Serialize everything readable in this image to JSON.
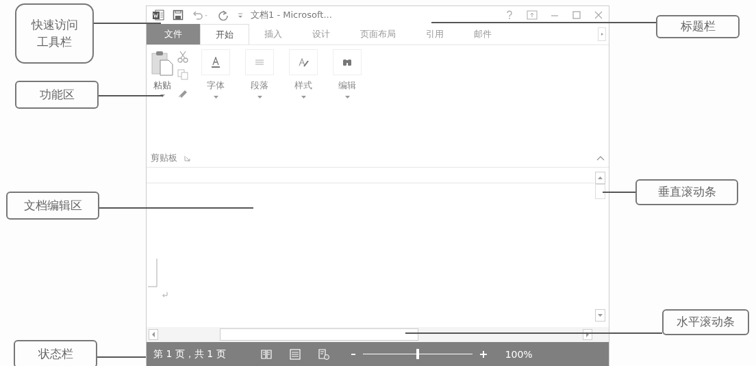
{
  "window": {
    "title": "文档1 - Microsoft..."
  },
  "tabs": [
    {
      "label": "文件",
      "kind": "file",
      "selected": false
    },
    {
      "label": "开始",
      "kind": "tab",
      "selected": true
    },
    {
      "label": "插入",
      "kind": "tab",
      "selected": false
    },
    {
      "label": "设计",
      "kind": "tab",
      "selected": false
    },
    {
      "label": "页面布局",
      "kind": "tab",
      "selected": false
    },
    {
      "label": "引用",
      "kind": "tab",
      "selected": false
    },
    {
      "label": "邮件",
      "kind": "tab",
      "selected": false
    }
  ],
  "ribbon": {
    "paste_label": "粘贴",
    "group_label": "剪贴板",
    "buttons": [
      {
        "label": "字体",
        "kind": "font"
      },
      {
        "label": "段落",
        "kind": "paragraph"
      },
      {
        "label": "样式",
        "kind": "styles"
      },
      {
        "label": "编辑",
        "kind": "find"
      }
    ]
  },
  "status_bar": {
    "page_info": "第 1 页，共 1 页",
    "zoom": {
      "level": 0.5,
      "reading": "100%"
    }
  },
  "callouts": [
    {
      "text": "快速访问工具栏",
      "kind": "rounded"
    },
    {
      "text": "功能区",
      "kind": "box"
    },
    {
      "text": "文档编辑区",
      "kind": "box"
    },
    {
      "text": "状态栏",
      "kind": "box"
    },
    {
      "text": "标题栏",
      "kind": "box"
    },
    {
      "text": "垂直滚动条",
      "kind": "box"
    },
    {
      "text": "水平滚动条",
      "kind": "box"
    }
  ]
}
